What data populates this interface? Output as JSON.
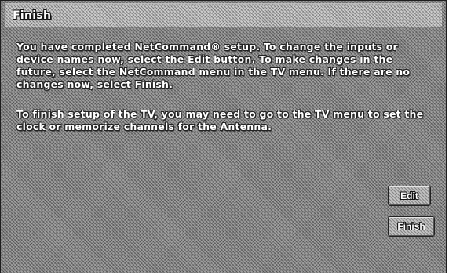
{
  "dialog": {
    "title": "Finish",
    "paragraph_1": "You have completed NetCommand® setup. To change the inputs or device names now, select the Edit button. To make changes in the future, select the NetCommand menu in the TV menu. If there are no changes now, select Finish.",
    "paragraph_2": "To finish setup of the TV, you may need to go to the TV menu to set the clock or memorize channels for the Antenna."
  },
  "buttons": {
    "edit_label": "Edit",
    "finish_label": "Finish"
  },
  "colors": {
    "background": "#9a9a9a",
    "title_bar": "#c9c9c9",
    "text": "#ffffff",
    "outline": "#1e1e1e"
  }
}
